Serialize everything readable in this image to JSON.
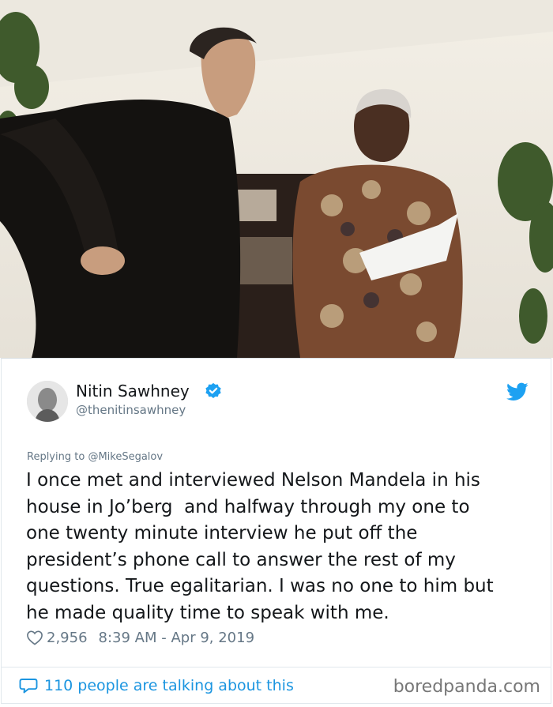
{
  "photo": {
    "alt_icon": "photo-mandela-interview"
  },
  "tweet": {
    "author_name": "Nitin Sawhney",
    "author_handle": "@thenitinsawhney",
    "replying_prefix": "Replying to",
    "replying_to": "@MikeSegalov",
    "text_lines": [
      "I once met and interviewed Nelson Mandela in his",
      "house in Jo’berg  and halfway through my one to",
      "one twenty minute interview he put off the",
      "president’s phone call to answer the rest of my",
      "questions. True egalitarian. I was no one to him but",
      "he made quality time to speak with me."
    ],
    "likes": "2,956",
    "timestamp": "8:39 AM - Apr 9, 2019",
    "talking": "110 people are talking about this"
  },
  "watermark": "boredpanda.com",
  "colors": {
    "twitter_blue": "#1da1f2",
    "link_blue": "#1b95e0",
    "muted": "#657786"
  },
  "icons": [
    "verified-badge-icon",
    "twitter-bird-icon",
    "heart-icon",
    "speech-bubble-icon"
  ]
}
